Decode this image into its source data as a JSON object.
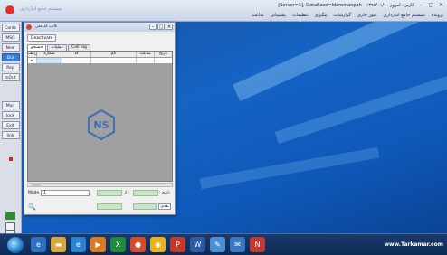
{
  "app_title": "[Server=1], DataBase=Idaremanpah",
  "quick_access": "سیستم جامع انبارداری",
  "title_extra": "کاربر : امروز   ۱۳۹۸/۰۱/۱۰",
  "menu": [
    "پرونده",
    "سیستم جامع انبارداری",
    "امور جاری",
    "گزارشات",
    "پیگیری",
    "تنظیمات",
    "پشتیبانی",
    "ساعت"
  ],
  "left_toolbar": [
    "Cards",
    "MSG",
    "New",
    "Dia",
    "Rep",
    "InOut",
    "Mod",
    "lock",
    "Exit",
    "link"
  ],
  "child": {
    "title": "کاتب کد ملی",
    "deactivate_label": "Deactivate",
    "tabs": [
      "جستجو",
      "عملیات",
      "Call log"
    ],
    "columns": [
      "ردیف",
      "شماره",
      "کد",
      "نام",
      "ساعت",
      "تاریخ"
    ],
    "row_indicator": "►",
    "watermark": "NS",
    "mode_label": "Mode :",
    "mode_value": "1",
    "date_label_1": ": تاریخ",
    "date_label_2": "از :",
    "next_label": "بعدی",
    "binoculars": "🔍"
  },
  "taskbar": {
    "tray_text": "www.Tarkamar.com",
    "icons": [
      "ie",
      "folder",
      "e",
      "media",
      "excel",
      "chrome",
      "ppt",
      "word",
      "paint",
      "mail",
      "ns"
    ]
  },
  "colors": {
    "desktop": "#1464c4",
    "taskbar": "#0e2a55",
    "grid_bg": "#a0a0a0",
    "watermark": "#3d6cb8"
  }
}
